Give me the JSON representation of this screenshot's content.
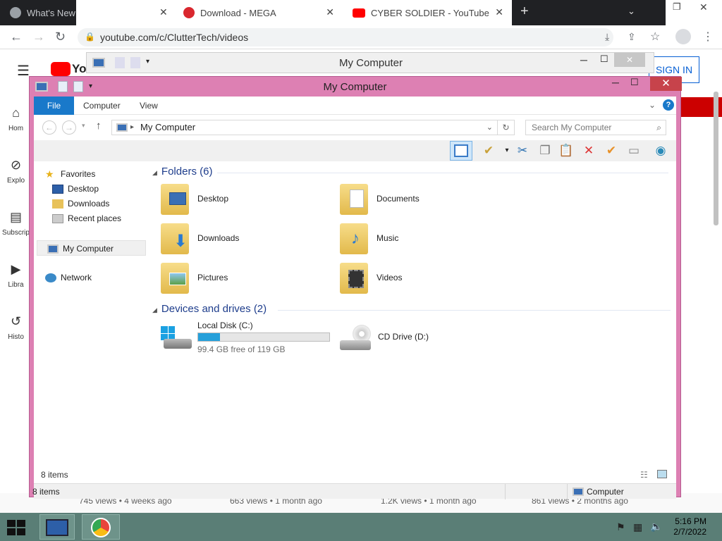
{
  "browser": {
    "tabs": [
      {
        "label": "What's New"
      },
      {
        "label": "Download - MEGA"
      },
      {
        "label": "CYBER SOLDIER - YouTube"
      }
    ],
    "url": "youtube.com/c/ClutterTech/videos"
  },
  "youtube": {
    "logo": "Yo",
    "sign_in": "SIGN IN",
    "sidebar": [
      "Hom",
      "Explo",
      "Subscrip",
      "Libra",
      "Histo"
    ],
    "video_stats": [
      "745 views • 4 weeks ago",
      "663 views • 1 month ago",
      "1.2K views • 1 month ago",
      "861 views • 2 months ago"
    ]
  },
  "back_window": {
    "title": "My Computer"
  },
  "explorer": {
    "title": "My Computer",
    "ribbon_tabs": [
      "File",
      "Computer",
      "View"
    ],
    "address": "My Computer",
    "search_placeholder": "Search My Computer",
    "nav": {
      "favorites": "Favorites",
      "fav_items": [
        "Desktop",
        "Downloads",
        "Recent places"
      ],
      "my_computer": "My Computer",
      "network": "Network"
    },
    "folders_header": "Folders (6)",
    "folders": [
      "Desktop",
      "Documents",
      "Downloads",
      "Music",
      "Pictures",
      "Videos"
    ],
    "devices_header": "Devices and drives (2)",
    "drives": [
      {
        "name": "Local Disk (C:)",
        "free_text": "99.4 GB free of 119 GB",
        "used_fraction": 0.165
      },
      {
        "name": "CD Drive (D:)"
      }
    ],
    "status_items": "8 items",
    "status_bottom_items": "8 items",
    "status_location": "Computer"
  },
  "taskbar": {
    "time": "5:16 PM",
    "date": "2/7/2022"
  },
  "colors": {
    "window_frame": "#dd80b3",
    "ribbon_file": "#1979ca",
    "close": "#c7434b",
    "taskbar": "#5a7e76",
    "drive_bar": "#26a0da"
  }
}
